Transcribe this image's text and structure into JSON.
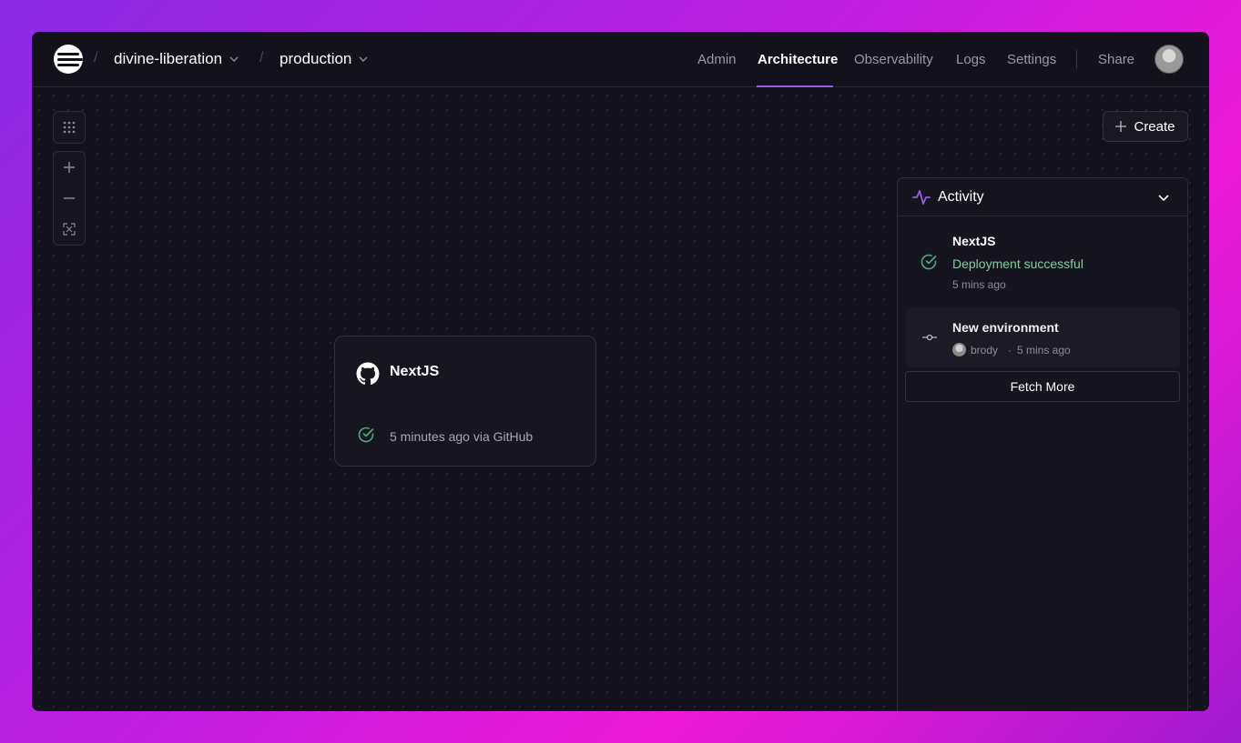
{
  "breadcrumb": {
    "project": "divine-liberation",
    "environment": "production",
    "separator": "/"
  },
  "nav": {
    "items": [
      "Admin",
      "Architecture",
      "Observability",
      "Logs",
      "Settings"
    ],
    "active": "Architecture",
    "share": "Share"
  },
  "toolbar": {
    "create_label": "Create"
  },
  "service_card": {
    "name": "NextJS",
    "icon": "github-icon",
    "status_text": "5 minutes ago via GitHub",
    "status_color": "#4caf7d"
  },
  "activity": {
    "title": "Activity",
    "items": [
      {
        "name": "NextJS",
        "message": "Deployment successful",
        "time": "5 mins ago",
        "icon": "check-circle-icon"
      },
      {
        "name": "New environment",
        "user": "brody",
        "time": "5 mins ago",
        "separator": "·",
        "icon": "commit-icon"
      }
    ],
    "fetch_more": "Fetch More"
  },
  "colors": {
    "accent": "#9b5de5",
    "success": "#4caf7d",
    "background": "#13111c"
  }
}
